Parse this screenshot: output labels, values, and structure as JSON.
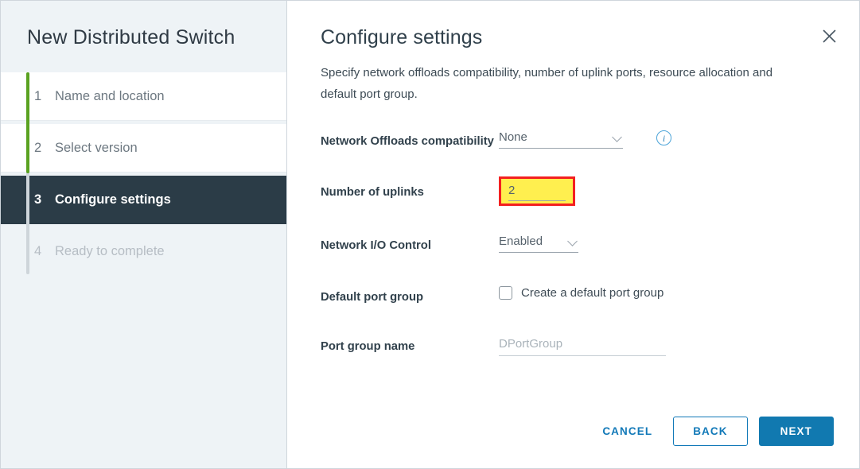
{
  "sidebar": {
    "title": "New Distributed Switch",
    "steps": [
      {
        "num": "1",
        "label": "Name and location",
        "state": "done"
      },
      {
        "num": "2",
        "label": "Select version",
        "state": "done"
      },
      {
        "num": "3",
        "label": "Configure settings",
        "state": "active"
      },
      {
        "num": "4",
        "label": "Ready to complete",
        "state": "upcoming"
      }
    ],
    "progress_color": "#5aa220",
    "active_color": "#2b3c47"
  },
  "panel": {
    "title": "Configure settings",
    "description": "Specify network offloads compatibility, number of uplink ports, resource allocation and default port group.",
    "close_icon": "close-icon"
  },
  "form": {
    "network_offloads": {
      "label": "Network Offloads compatibility",
      "value": "None",
      "chevron_icon": "chevron-down-icon",
      "info_icon": "info-icon",
      "info_glyph": "i"
    },
    "uplinks": {
      "label": "Number of uplinks",
      "value": "2",
      "highlight_border": "#f32020",
      "highlight_fill": "#ffef4f"
    },
    "nioc": {
      "label": "Network I/O Control",
      "value": "Enabled",
      "chevron_icon": "chevron-down-icon"
    },
    "default_port_group": {
      "label": "Default port group",
      "checkbox_label": "Create a default port group",
      "checked": false
    },
    "port_group_name": {
      "label": "Port group name",
      "value": "",
      "placeholder": "DPortGroup"
    }
  },
  "footer": {
    "cancel_label": "CANCEL",
    "back_label": "BACK",
    "next_label": "NEXT",
    "accent_color": "#1179b0"
  }
}
